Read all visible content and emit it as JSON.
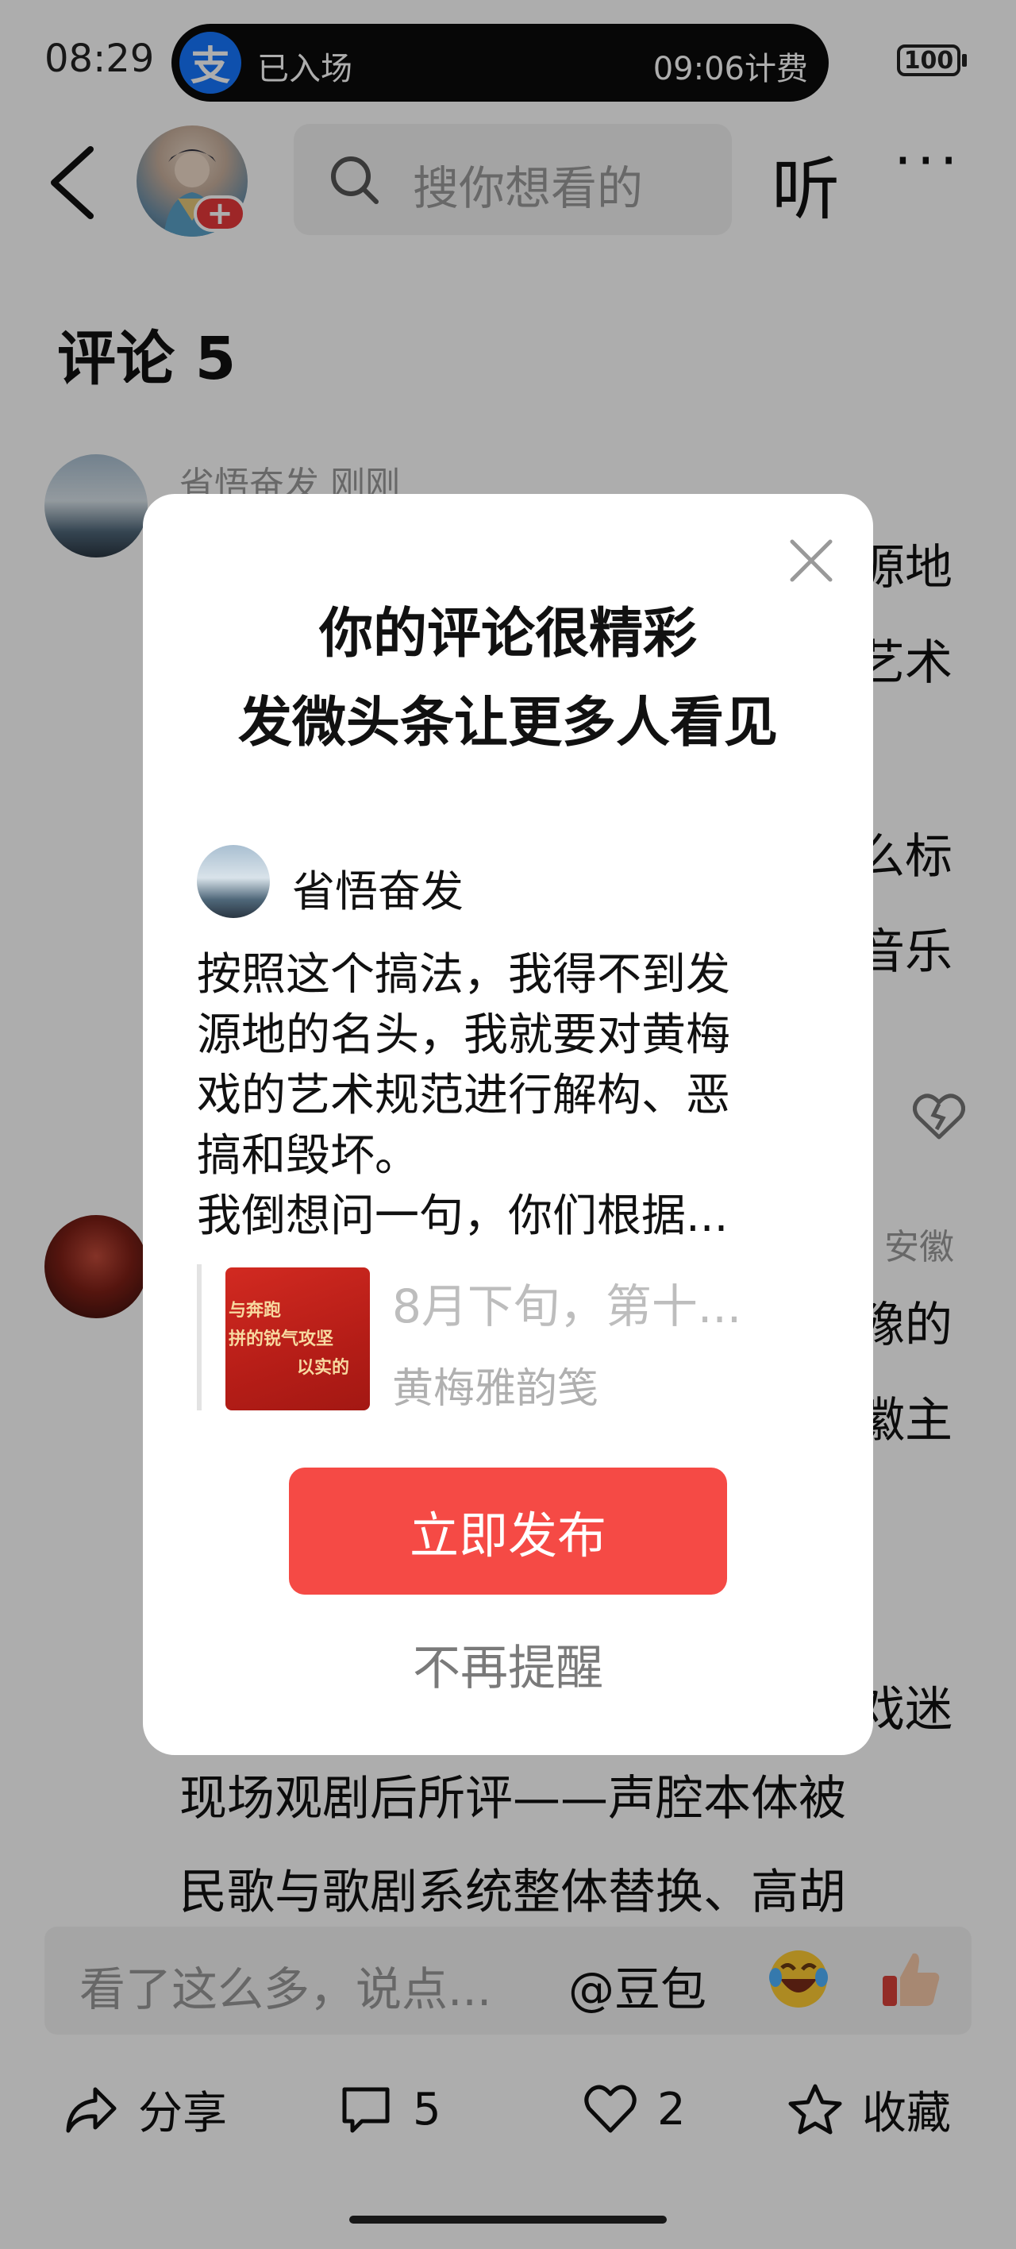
{
  "status_bar": {
    "time": "08:29",
    "pill_logo": "支",
    "pill_left": "已入场",
    "pill_right": "09:06计费",
    "battery": "100"
  },
  "nav": {
    "search_placeholder": "搜你想看的",
    "listen_label": "听",
    "more_label": "···"
  },
  "comments": {
    "title": "评论 5",
    "comment1": {
      "author_time": "省悟奋发  刚刚",
      "visible_fragments": [
        "源地",
        "艺术",
        "么标",
        "音乐"
      ]
    },
    "comment2": {
      "visible_fragments": [
        "安徽",
        "豫的",
        "徽主",
        "戏迷"
      ],
      "text_line1": "现场观剧后所评——声腔本体被",
      "text_line2": "民歌与歌剧系统整体替换、高胡"
    }
  },
  "modal": {
    "title_line1": "你的评论很精彩",
    "title_line2": "发微头条让更多人看见",
    "quote": {
      "author": "省悟奋发",
      "lines": [
        "按照这个搞法，我得不到发",
        "源地的名头，我就要对黄梅",
        "戏的艺术规范进行解构、恶",
        "搞和毁坏。",
        "我倒想问一句，你们根据..."
      ]
    },
    "article": {
      "title": "8月下旬，第十...",
      "source": "黄梅雅韵笺",
      "thumb_text": [
        "与奔跑",
        "拼的锐气攻坚",
        "以实的"
      ]
    },
    "publish_label": "立即发布",
    "no_remind_label": "不再提醒"
  },
  "input_bar": {
    "placeholder": "看了这么多，说点...",
    "doubao_label": "@豆包"
  },
  "bottom_bar": {
    "share_label": "分享",
    "comment_count": "5",
    "like_count": "2",
    "favorite_label": "收藏"
  },
  "colors": {
    "accent_red": "#f54a45",
    "alipay_blue": "#1677ff",
    "overlay": "rgba(0,0,0,0.32)"
  }
}
